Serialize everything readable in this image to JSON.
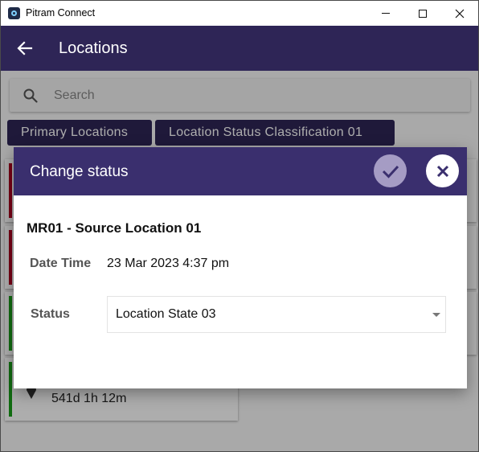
{
  "window": {
    "title": "Pitram Connect"
  },
  "appbar": {
    "title": "Locations"
  },
  "search": {
    "placeholder": "Search"
  },
  "chips": [
    {
      "label": "Primary Locations"
    },
    {
      "label": "Location Status Classification 01"
    }
  ],
  "cards": [
    {
      "status_color": "#b00020"
    },
    {
      "status_color": "#b00020"
    },
    {
      "status_color": "#1aa01a"
    },
    {
      "status_color": "#1aa01a",
      "duration": "541d 1h 12m"
    }
  ],
  "dialog": {
    "title": "Change status",
    "location_name": "MR01 - Source Location 01",
    "date_time_label": "Date Time",
    "date_time_value": "23 Mar 2023 4:37 pm",
    "status_label": "Status",
    "status_value": "Location State 03"
  },
  "colors": {
    "appbar": "#2e2556",
    "dialog_header": "#3a2f6e",
    "confirm_button": "#a59cc4"
  },
  "icons": {
    "back": "back-arrow-icon",
    "search": "search-icon",
    "confirm": "check-icon",
    "close": "close-icon",
    "dropdown": "chevron-down-icon"
  }
}
